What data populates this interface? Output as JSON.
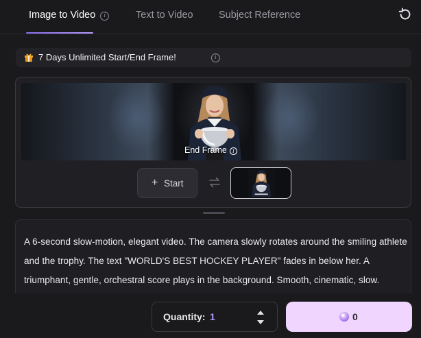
{
  "tabs": [
    {
      "label": "Image to Video"
    },
    {
      "label": "Text to Video"
    },
    {
      "label": "Subject Reference"
    }
  ],
  "active_tab": "Image to Video",
  "promo": {
    "text": "7 Days Unlimited Start/End Frame!"
  },
  "frames": {
    "end_frame_label": "End Frame",
    "start_button_label": "Start"
  },
  "prompt": {
    "text": "A 6-second slow-motion, elegant video. The camera slowly rotates around the smiling athlete and the trophy. The text \"WORLD'S BEST HOCKEY PLAYER\" fades in below her. A triumphant, gentle, orchestral score plays in the background. Smooth, cinematic, slow."
  },
  "quantity": {
    "label": "Quantity:",
    "value": "1"
  },
  "generate": {
    "credits": "0"
  },
  "icons": {
    "info": "info-icon",
    "refresh": "refresh-icon",
    "gift": "gift-icon",
    "plus": "plus-icon",
    "swap": "swap-icon",
    "chevron_up": "chevron-up-icon",
    "chevron_down": "chevron-down-icon",
    "gem": "gem-icon"
  },
  "colors": {
    "accent": "#b49cff",
    "generate_bg": "#f0d6ff",
    "background": "#1a1a1d",
    "gift": "#f5a623"
  }
}
